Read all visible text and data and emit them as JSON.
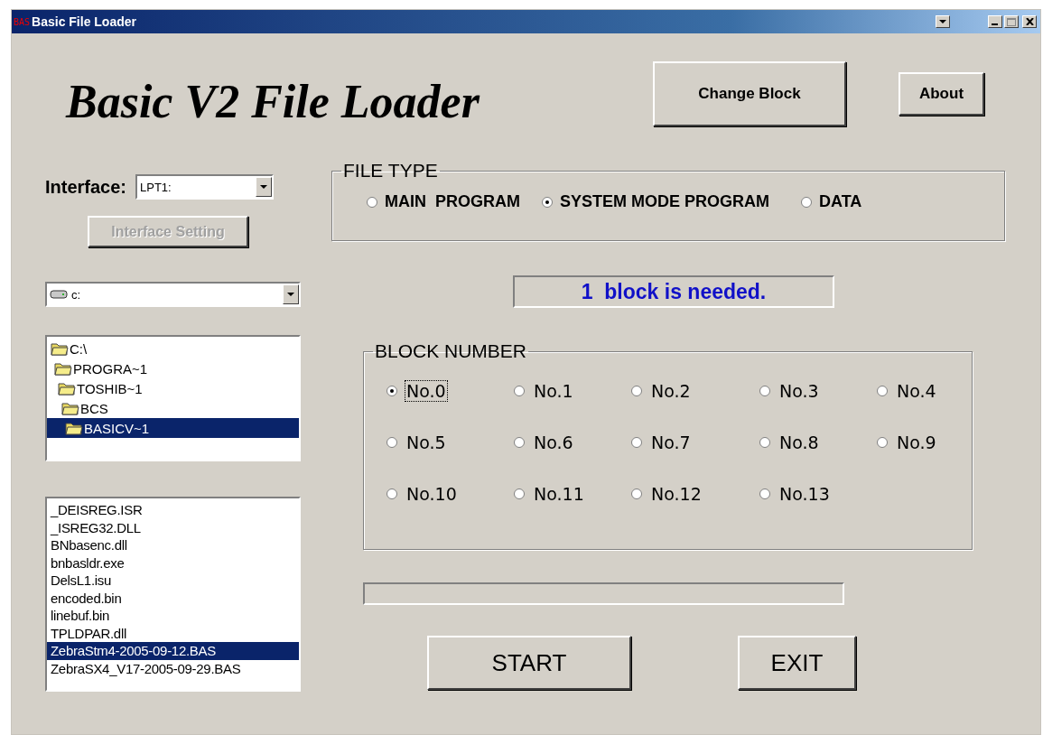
{
  "window": {
    "icon_text": "BAS",
    "title": "Basic File Loader"
  },
  "heading": "Basic V2 File Loader",
  "top_buttons": [
    {
      "label": "Change Block"
    },
    {
      "label": "About"
    }
  ],
  "interface": {
    "label": "Interface:",
    "value": "LPT1:"
  },
  "interface_setting": {
    "label": "Interface Setting",
    "disabled": true
  },
  "drive": {
    "value": "c:"
  },
  "folders": [
    {
      "name": "C:\\",
      "selected": false,
      "children": [
        {
          "name": "PROGRA~1",
          "selected": false,
          "children": [
            {
              "name": "TOSHIB~1",
              "selected": false,
              "children": [
                {
                  "name": "BCS",
                  "selected": false,
                  "children": [
                    {
                      "name": "BASICV~1",
                      "selected": true
                    }
                  ]
                }
              ]
            }
          ]
        }
      ]
    }
  ],
  "files": [
    {
      "name": "_DEISREG.ISR",
      "selected": false
    },
    {
      "name": "_ISREG32.DLL",
      "selected": false
    },
    {
      "name": "BNbasenc.dll",
      "selected": false
    },
    {
      "name": "bnbasldr.exe",
      "selected": false
    },
    {
      "name": "DelsL1.isu",
      "selected": false
    },
    {
      "name": "encoded.bin",
      "selected": false
    },
    {
      "name": "linebuf.bin",
      "selected": false
    },
    {
      "name": "TPLDPAR.dll",
      "selected": false
    },
    {
      "name": "ZebraStm4-2005-09-12.BAS",
      "selected": true
    },
    {
      "name": "ZebraSX4_V17-2005-09-29.BAS",
      "selected": false
    }
  ],
  "file_type": {
    "title": "FILE TYPE",
    "options": [
      {
        "label": "MAIN  PROGRAM",
        "selected": false
      },
      {
        "label": "SYSTEM MODE PROGRAM",
        "selected": true
      },
      {
        "label": "DATA",
        "selected": false
      }
    ]
  },
  "status": "1  block is needed.",
  "block_number": {
    "title": "BLOCK NUMBER",
    "options": [
      {
        "label": "No.0",
        "selected": true
      },
      {
        "label": "No.1",
        "selected": false
      },
      {
        "label": "No.2",
        "selected": false
      },
      {
        "label": "No.3",
        "selected": false
      },
      {
        "label": "No.4",
        "selected": false
      },
      {
        "label": "No.5",
        "selected": false
      },
      {
        "label": "No.6",
        "selected": false
      },
      {
        "label": "No.7",
        "selected": false
      },
      {
        "label": "No.8",
        "selected": false
      },
      {
        "label": "No.9",
        "selected": false
      },
      {
        "label": "No.10",
        "selected": false
      },
      {
        "label": "No.11",
        "selected": false
      },
      {
        "label": "No.12",
        "selected": false
      },
      {
        "label": "No.13",
        "selected": false
      }
    ]
  },
  "progress": {
    "level": 0
  },
  "bottom_buttons": [
    {
      "label": "START"
    },
    {
      "label": "EXIT"
    }
  ]
}
